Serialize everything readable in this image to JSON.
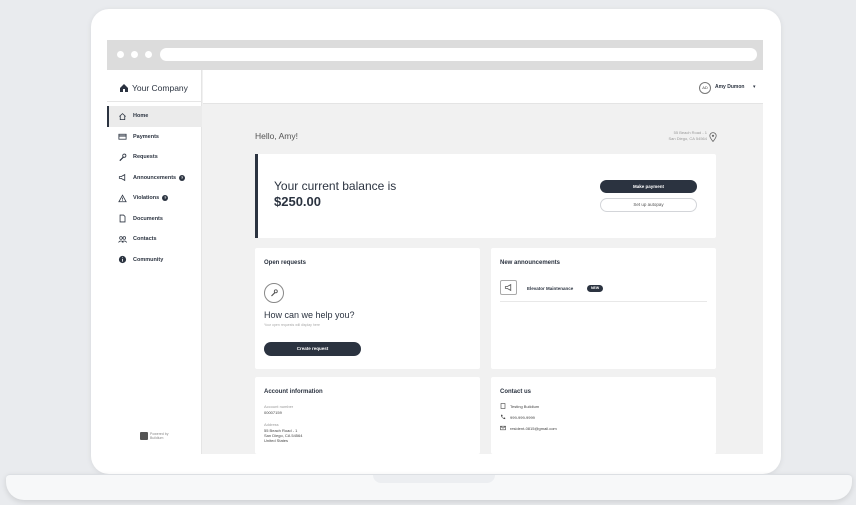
{
  "browser": {
    "dots": 3
  },
  "company": {
    "name": "Your Company"
  },
  "nav": {
    "items": [
      {
        "label": "Home",
        "icon": "home-icon",
        "active": true,
        "badge": false
      },
      {
        "label": "Payments",
        "icon": "credit-card-icon",
        "active": false,
        "badge": false
      },
      {
        "label": "Requests",
        "icon": "wrench-icon",
        "active": false,
        "badge": false
      },
      {
        "label": "Announcements",
        "icon": "megaphone-icon",
        "active": false,
        "badge": true
      },
      {
        "label": "Violations",
        "icon": "warning-icon",
        "active": false,
        "badge": true
      },
      {
        "label": "Documents",
        "icon": "document-icon",
        "active": false,
        "badge": false
      },
      {
        "label": "Contacts",
        "icon": "people-icon",
        "active": false,
        "badge": false
      },
      {
        "label": "Community",
        "icon": "info-icon",
        "active": false,
        "badge": false
      }
    ]
  },
  "powered_by": {
    "line1": "Powered by",
    "line2": "Buildium"
  },
  "user": {
    "initials": "AD",
    "name": "Amy Dumon"
  },
  "main": {
    "greeting": "Hello, Amy!",
    "address_line1": "55 Beach Road - 1",
    "address_line2": "San Diego, CA 54564"
  },
  "balance": {
    "label": "Your current balance is",
    "amount": "$250.00",
    "make_payment": "Make payment",
    "autopay": "Set up autopay"
  },
  "requests": {
    "title": "Open requests",
    "help": "How can we help you?",
    "sub": "Your open requests will display here",
    "create": "Create request"
  },
  "announcements": {
    "title": "New announcements",
    "item_title": "Elevator Maintenance",
    "item_badge": "NEW"
  },
  "account": {
    "title": "Account information",
    "number_label": "Account number",
    "number": "00007159",
    "address_label": "Address",
    "address_line1": "55 Beach Road - 1",
    "address_line2": "San Diego, CA 54564",
    "address_line3": "United States"
  },
  "contact": {
    "title": "Contact us",
    "company": "Testing Buildium",
    "phone": "999-999-9999",
    "email": "resident-0815@gmail.com"
  },
  "colors": {
    "primary": "#2b3340",
    "background": "#f1f1f1"
  }
}
